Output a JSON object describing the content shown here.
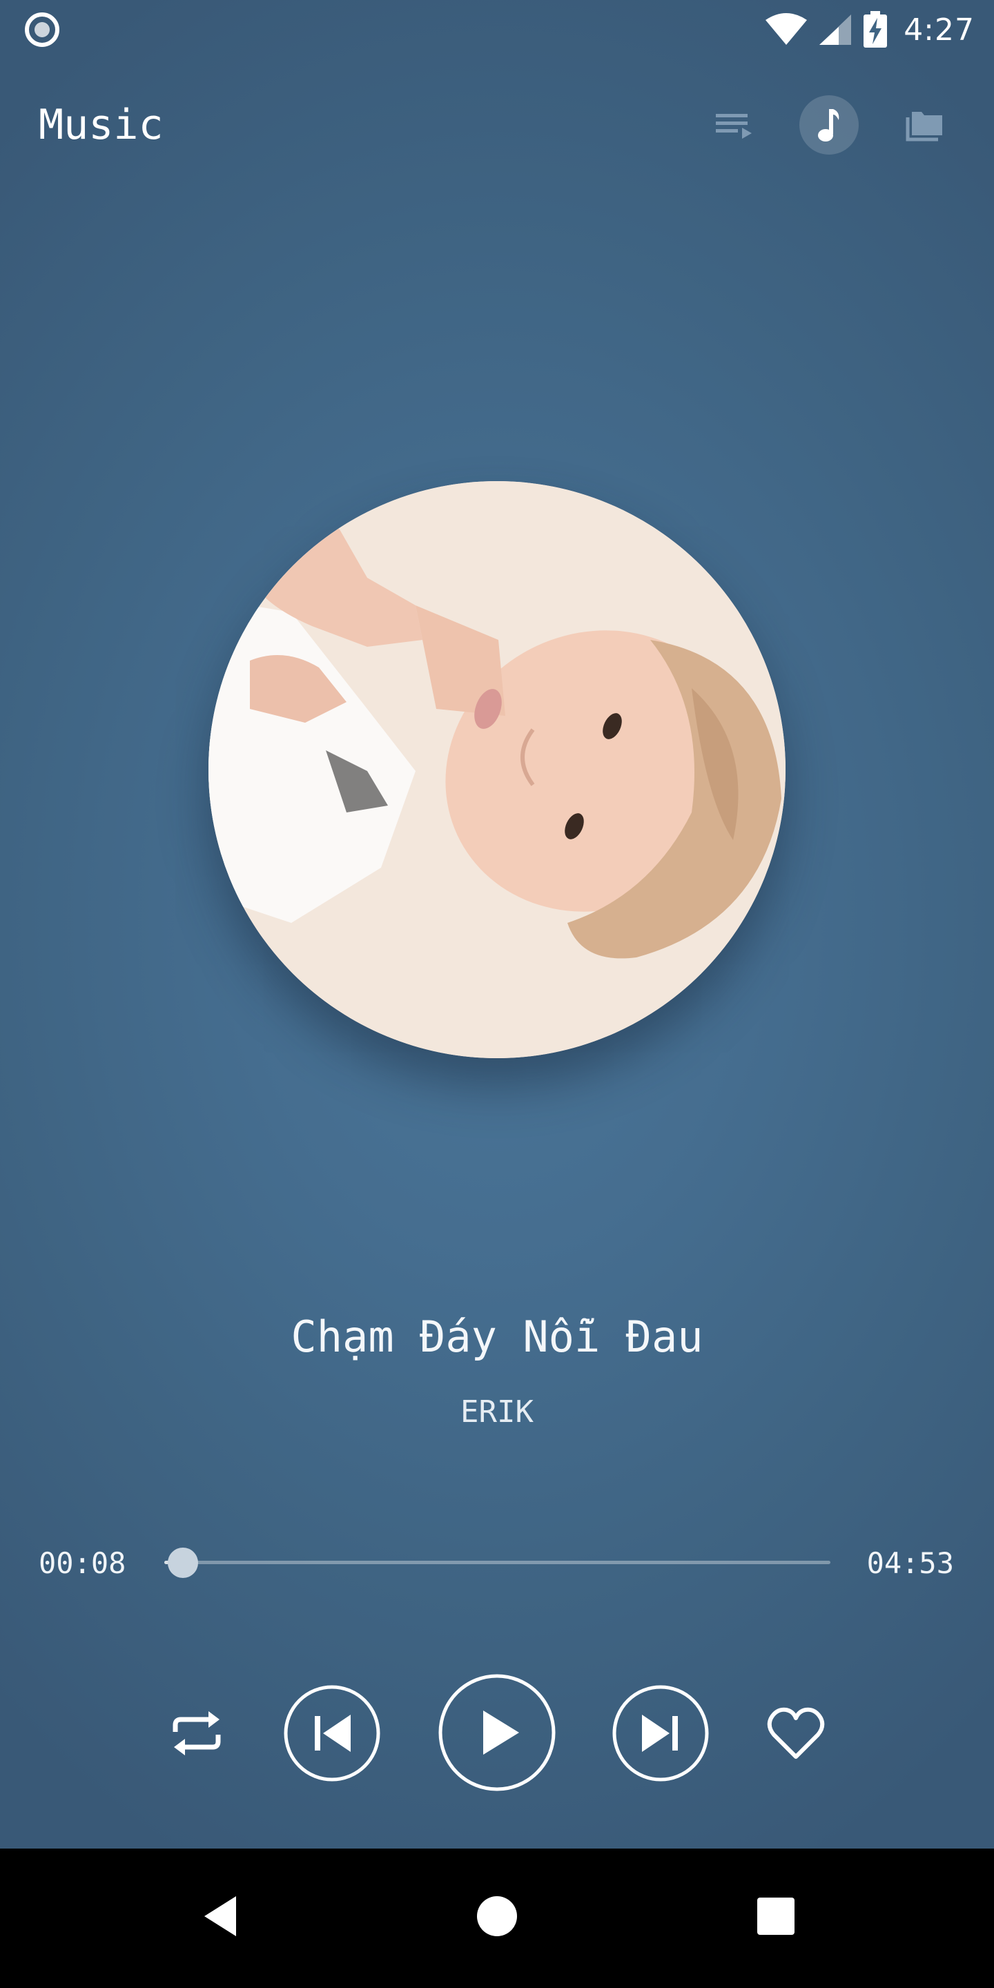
{
  "status_bar": {
    "time": "4:27",
    "icons": [
      "recording-dot-icon",
      "wifi-icon",
      "cell-signal-icon",
      "battery-charging-icon"
    ]
  },
  "header": {
    "title": "Music",
    "actions": [
      {
        "icon": "queue-icon",
        "active": false
      },
      {
        "icon": "music-note-icon",
        "active": true
      },
      {
        "icon": "folder-icon",
        "active": false
      }
    ]
  },
  "now_playing": {
    "song_title": "Chạm Đáy Nỗi Đau",
    "artist": "ERIK",
    "elapsed": "00:08",
    "duration": "04:53",
    "progress": 0.028
  },
  "controls": [
    "repeat-icon",
    "previous-icon",
    "play-icon",
    "next-icon",
    "heart-icon"
  ],
  "nav_bar": [
    "back-icon",
    "home-icon",
    "recents-icon"
  ],
  "colors": {
    "background": "#45708f",
    "accent": "#ffffff",
    "nav_bar": "#000000"
  }
}
